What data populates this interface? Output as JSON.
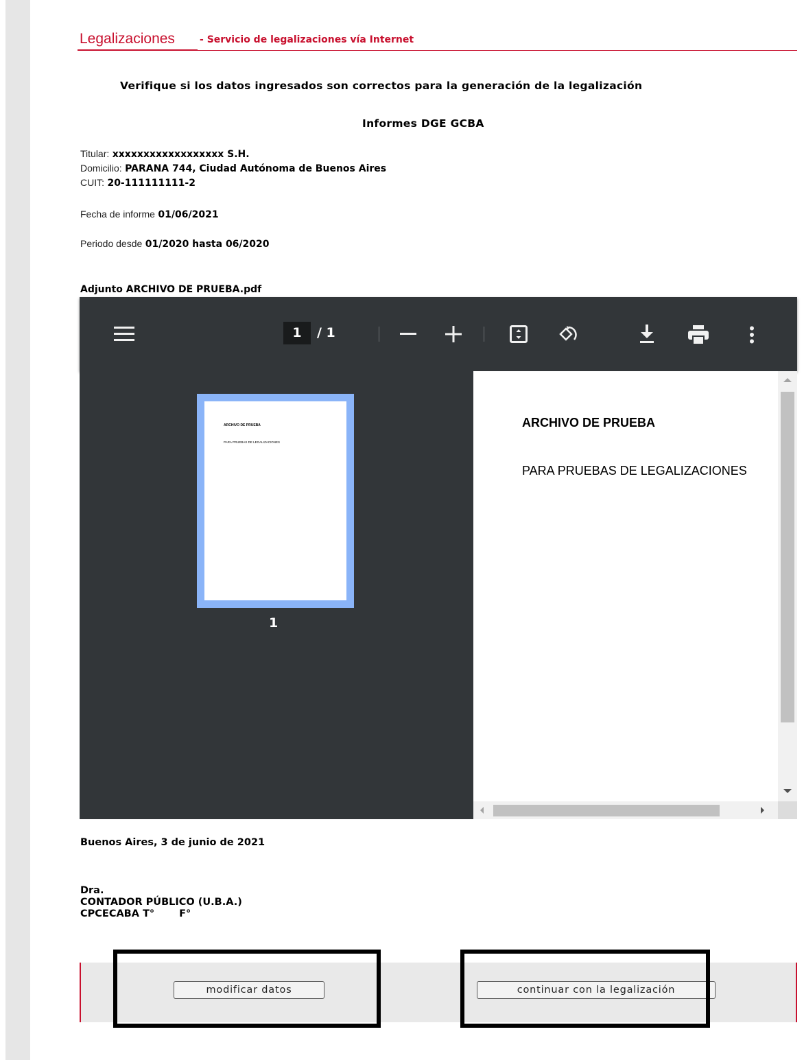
{
  "header": {
    "title": "Legalizaciones",
    "separator": "-",
    "subtitle": "Servicio de legalizaciones vía Internet"
  },
  "main": {
    "heading": "Verifique si los datos ingresados son correctos para la generación de la legalización",
    "subheading": "Informes DGE GCBA",
    "titular_label": "Titular:",
    "titular_value": "xxxxxxxxxxxxxxxxxx S.H.",
    "domicilio_label": "Domicilio:",
    "domicilio_value": "PARANA 744, Ciudad Autónoma de Buenos Aires",
    "cuit_label": "CUIT:",
    "cuit_value": "20-111111111-2",
    "fecha_label": "Fecha de informe",
    "fecha_value": "01/06/2021",
    "periodo_label": "Periodo desde",
    "periodo_value": "01/2020 hasta 06/2020",
    "adjunto": "Adjunto ARCHIVO DE PRUEBA.pdf"
  },
  "pdf_viewer": {
    "current_page": "1",
    "page_total": "/ 1",
    "thumbnail_number": "1",
    "thumbnail_title": "ARCHIVO DE PRUEBA",
    "thumbnail_subtitle": "PARA PRUEBAS DE LEGALIZACIONES",
    "doc_title": "ARCHIVO DE PRUEBA",
    "doc_subtitle": "PARA PRUEBAS DE LEGALIZACIONES",
    "icons": [
      "menu-icon",
      "zoom-out-icon",
      "zoom-in-icon",
      "fit-page-icon",
      "rotate-icon",
      "download-icon",
      "print-icon",
      "more-options-icon"
    ]
  },
  "footer": {
    "date": "Buenos Aires, 3 de junio de 2021",
    "sig_line1": "Dra.",
    "sig_line2": "CONTADOR PÚBLICO (U.B.A.)",
    "sig_tomo": "CPCECABA T°",
    "sig_folio": "F°"
  },
  "actions": {
    "modify_label": "modificar datos",
    "continue_label": "continuar con la legalización"
  },
  "colors": {
    "accent": "#c8102e",
    "viewer_bg": "#323639",
    "thumbnail_highlight": "#8ab4f8",
    "annotation_box": "#000000"
  }
}
